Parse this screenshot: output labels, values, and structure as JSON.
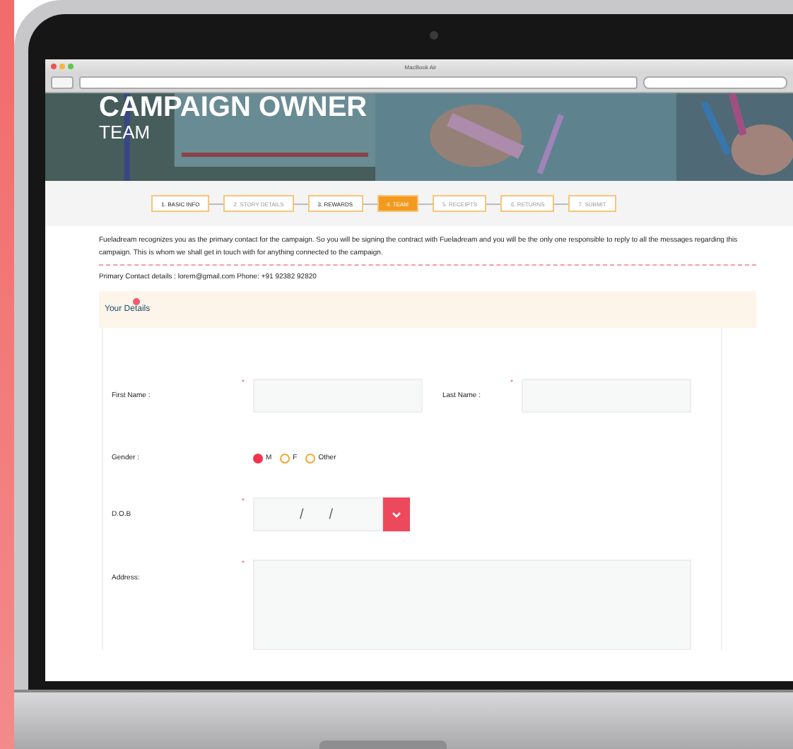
{
  "browser": {
    "title": "MacBook Air"
  },
  "header": {
    "title": "CAMPAIGN OWNER",
    "subtitle": "TEAM"
  },
  "steps": [
    {
      "label": "1. BASIC INFO",
      "selected": false,
      "visited": true
    },
    {
      "label": "2. STORY DETAILS",
      "selected": false,
      "visited": false
    },
    {
      "label": "3. REWARDS",
      "selected": false,
      "visited": true
    },
    {
      "label": "4. TEAM",
      "selected": true,
      "visited": false
    },
    {
      "label": "5. RECEIPTS",
      "selected": false,
      "visited": false
    },
    {
      "label": "6. RETURNS",
      "selected": false,
      "visited": false
    },
    {
      "label": "7. SUBMIT",
      "selected": false,
      "visited": false
    }
  ],
  "intro": "Fueladream recognizes you as the primary contact for the campaign. So you will be signing the contract with Fueladream and you will be the only one responsible to reply to all the messages regarding this campaign. This is whom we shall get in touch with for anything connected to the campaign.",
  "contact": "Primary Contact details : lorem@gmail.com  Phone: +91 92382 92820",
  "section": {
    "title": "Your Details"
  },
  "form": {
    "first_name": {
      "label": "First Name :",
      "required_mark": "*"
    },
    "last_name": {
      "label": "Last Name :",
      "required_mark": "*"
    },
    "gender": {
      "label": "Gender :",
      "options": [
        {
          "label": "M",
          "selected": true
        },
        {
          "label": "F",
          "selected": false
        },
        {
          "label": "Other",
          "selected": false
        }
      ]
    },
    "dob": {
      "label": "D.O.B",
      "required_mark": "*",
      "separators": [
        "/",
        "/"
      ]
    },
    "address": {
      "label": "Address:",
      "required_mark": "*"
    }
  }
}
